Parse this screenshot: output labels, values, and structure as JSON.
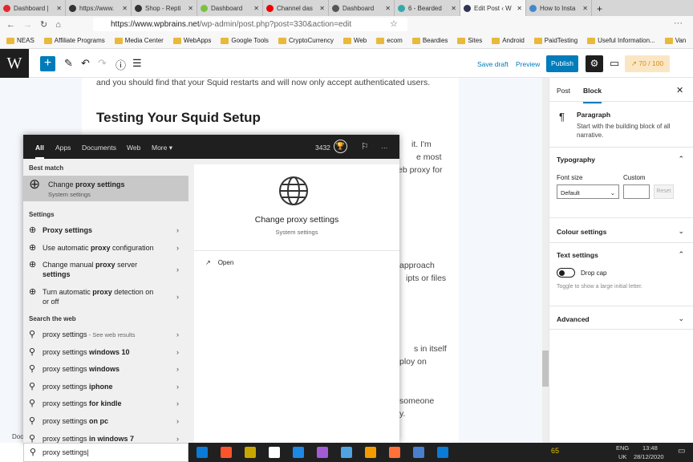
{
  "browser": {
    "tabs": [
      {
        "title": "Dashboard |",
        "color": "#e3262e"
      },
      {
        "title": "https://www.",
        "color": "#333"
      },
      {
        "title": "Shop - Repti",
        "color": "#333"
      },
      {
        "title": "Dashboard",
        "color": "#7ac143"
      },
      {
        "title": "Channel das",
        "color": "#e00"
      },
      {
        "title": "Dashboard",
        "color": "#555"
      },
      {
        "title": "6 - Bearded",
        "color": "#3aa"
      },
      {
        "title": "Edit Post ‹ W",
        "color": "#335",
        "active": true
      },
      {
        "title": "How to Insta",
        "color": "#48c"
      }
    ],
    "url_domain": "https://www.wpbrains.net",
    "url_path": "/wp-admin/post.php?post=330&action=edit",
    "bookmarks": [
      "NEAS",
      "Affiliate Programs",
      "Media Center",
      "WebApps",
      "Google Tools",
      "CryptoCurrency",
      "Web",
      "ecom",
      "Beardies",
      "Sites",
      "Android",
      "PaidTesting",
      "Useful Information...",
      "Van"
    ]
  },
  "wp": {
    "save_draft": "Save draft",
    "preview": "Preview",
    "publish": "Publish",
    "score": "70 / 100",
    "content": {
      "line_top": "and you should find that your Squid restarts and will now only accept authenticated users.",
      "heading": "Testing Your Squid Setup",
      "frag": [
        "it. I'm",
        "e most",
        "eb proxy for",
        "approach",
        "ipts or files",
        "s in itself",
        "ploy on",
        "someone",
        "y."
      ]
    },
    "sidebar": {
      "tabs": [
        "Post",
        "Block"
      ],
      "block_name": "Paragraph",
      "block_desc": "Start with the building block of all narrative.",
      "typography": "Typography",
      "font_size": "Font size",
      "custom": "Custom",
      "font_default": "Default",
      "reset": "Reset",
      "colour": "Colour settings",
      "text_settings": "Text settings",
      "drop_cap": "Drop cap",
      "drop_cap_help": "Toggle to show a large initial letter.",
      "advanced": "Advanced"
    },
    "status": "Doc"
  },
  "search": {
    "filters": [
      "All",
      "Apps",
      "Documents",
      "Web",
      "More ▾"
    ],
    "points": "3432",
    "best_match_label": "Best match",
    "best": {
      "title_pre": "Change ",
      "title_bold": "proxy settings",
      "sub": "System settings"
    },
    "settings_label": "Settings",
    "settings": [
      {
        "a": "",
        "b": "Proxy settings",
        "c": "",
        "d": ""
      },
      {
        "a": "Use automatic ",
        "b": "proxy",
        "c": " configuration",
        "d": ""
      },
      {
        "a": "Change manual ",
        "b": "proxy",
        "c": " server",
        "d": "settings"
      },
      {
        "a": "Turn automatic ",
        "b": "proxy",
        "c": " detection on",
        "d": "or off"
      }
    ],
    "web_label": "Search the web",
    "web": [
      {
        "q": "proxy settings",
        "b": "",
        "s": " - See web results"
      },
      {
        "q": "proxy settings ",
        "b": "windows 10",
        "s": ""
      },
      {
        "q": "proxy settings ",
        "b": "windows",
        "s": ""
      },
      {
        "q": "proxy settings ",
        "b": "iphone",
        "s": ""
      },
      {
        "q": "proxy settings ",
        "b": "for kindle",
        "s": ""
      },
      {
        "q": "proxy settings ",
        "b": "on pc",
        "s": ""
      },
      {
        "q": "proxy settings ",
        "b": "in windows 7",
        "s": ""
      }
    ],
    "preview_title": "Change proxy settings",
    "preview_sub": "System settings",
    "open": "Open",
    "query": "proxy settings"
  },
  "taskbar": {
    "lang": "ENG",
    "region": "UK",
    "time": "13:48",
    "date": "28/12/2020",
    "badge": "65"
  }
}
